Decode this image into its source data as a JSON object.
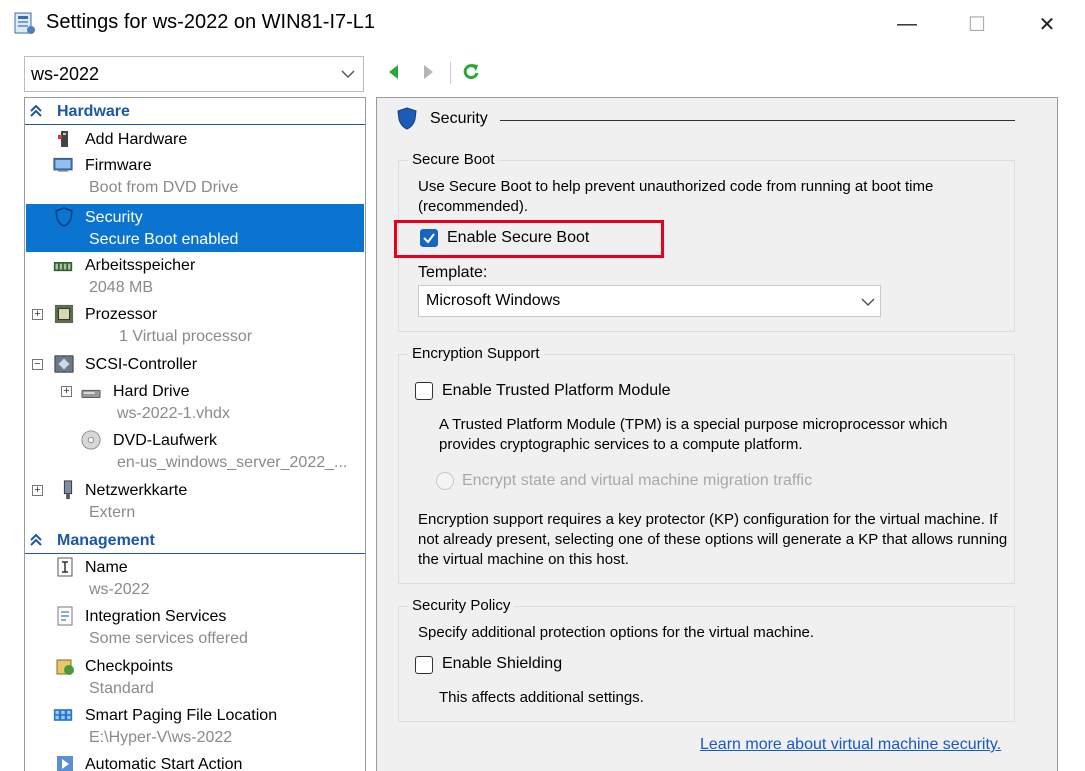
{
  "window": {
    "title": "Settings for ws-2022 on WIN81-I7-L1",
    "minimize_glyph": "—",
    "maximize_glyph": "☐",
    "close_glyph": "✕"
  },
  "vm_selector": {
    "value": "ws-2022"
  },
  "toolbar": {
    "back_icon": "back-arrow-icon",
    "forward_icon": "forward-arrow-icon",
    "refresh_icon": "refresh-icon"
  },
  "tree": {
    "hardware_header": "Hardware",
    "management_header": "Management",
    "items": [
      {
        "title": "Add Hardware"
      },
      {
        "title": "Firmware",
        "sub": "Boot from DVD Drive"
      },
      {
        "title": "Security",
        "sub": "Secure Boot enabled"
      },
      {
        "title": "Arbeitsspeicher",
        "sub": "2048 MB"
      },
      {
        "title": "Prozessor",
        "sub": "1 Virtual processor"
      },
      {
        "title": "SCSI-Controller"
      },
      {
        "title": "Hard Drive",
        "sub": "ws-2022-1.vhdx"
      },
      {
        "title": "DVD-Laufwerk",
        "sub": "en-us_windows_server_2022_..."
      },
      {
        "title": "Netzwerkkarte",
        "sub": "Extern"
      },
      {
        "title": "Name",
        "sub": "ws-2022"
      },
      {
        "title": "Integration Services",
        "sub": "Some services offered"
      },
      {
        "title": "Checkpoints",
        "sub": "Standard"
      },
      {
        "title": "Smart Paging File Location",
        "sub": "E:\\Hyper-V\\ws-2022"
      },
      {
        "title": "Automatic Start Action"
      }
    ]
  },
  "panel": {
    "heading": "Security",
    "secure_boot": {
      "group_title": "Secure Boot",
      "description": "Use Secure Boot to help prevent unauthorized code from running at boot time (recommended).",
      "checkbox_label": "Enable Secure Boot",
      "checked": true,
      "template_label": "Template:",
      "template_value": "Microsoft Windows"
    },
    "encryption": {
      "group_title": "Encryption Support",
      "tpm_label": "Enable Trusted Platform Module",
      "tpm_description": "A Trusted Platform Module (TPM) is a special purpose microprocessor which provides cryptographic services to a compute platform.",
      "encrypt_label": "Encrypt state and virtual machine migration traffic",
      "kp_note": "Encryption support requires a key protector (KP) configuration for the virtual machine. If not already present, selecting one of these options will generate a KP that allows running the virtual machine on this host."
    },
    "policy": {
      "group_title": "Security Policy",
      "description": "Specify additional protection options for the virtual machine.",
      "shielding_label": "Enable Shielding",
      "shielding_note": "This affects additional settings."
    },
    "learn_more": "Learn more about virtual machine security."
  },
  "colors": {
    "accent": "#0a74d0",
    "section_header": "#1c56a8",
    "highlight": "#e8001c",
    "link": "#1559c7"
  }
}
